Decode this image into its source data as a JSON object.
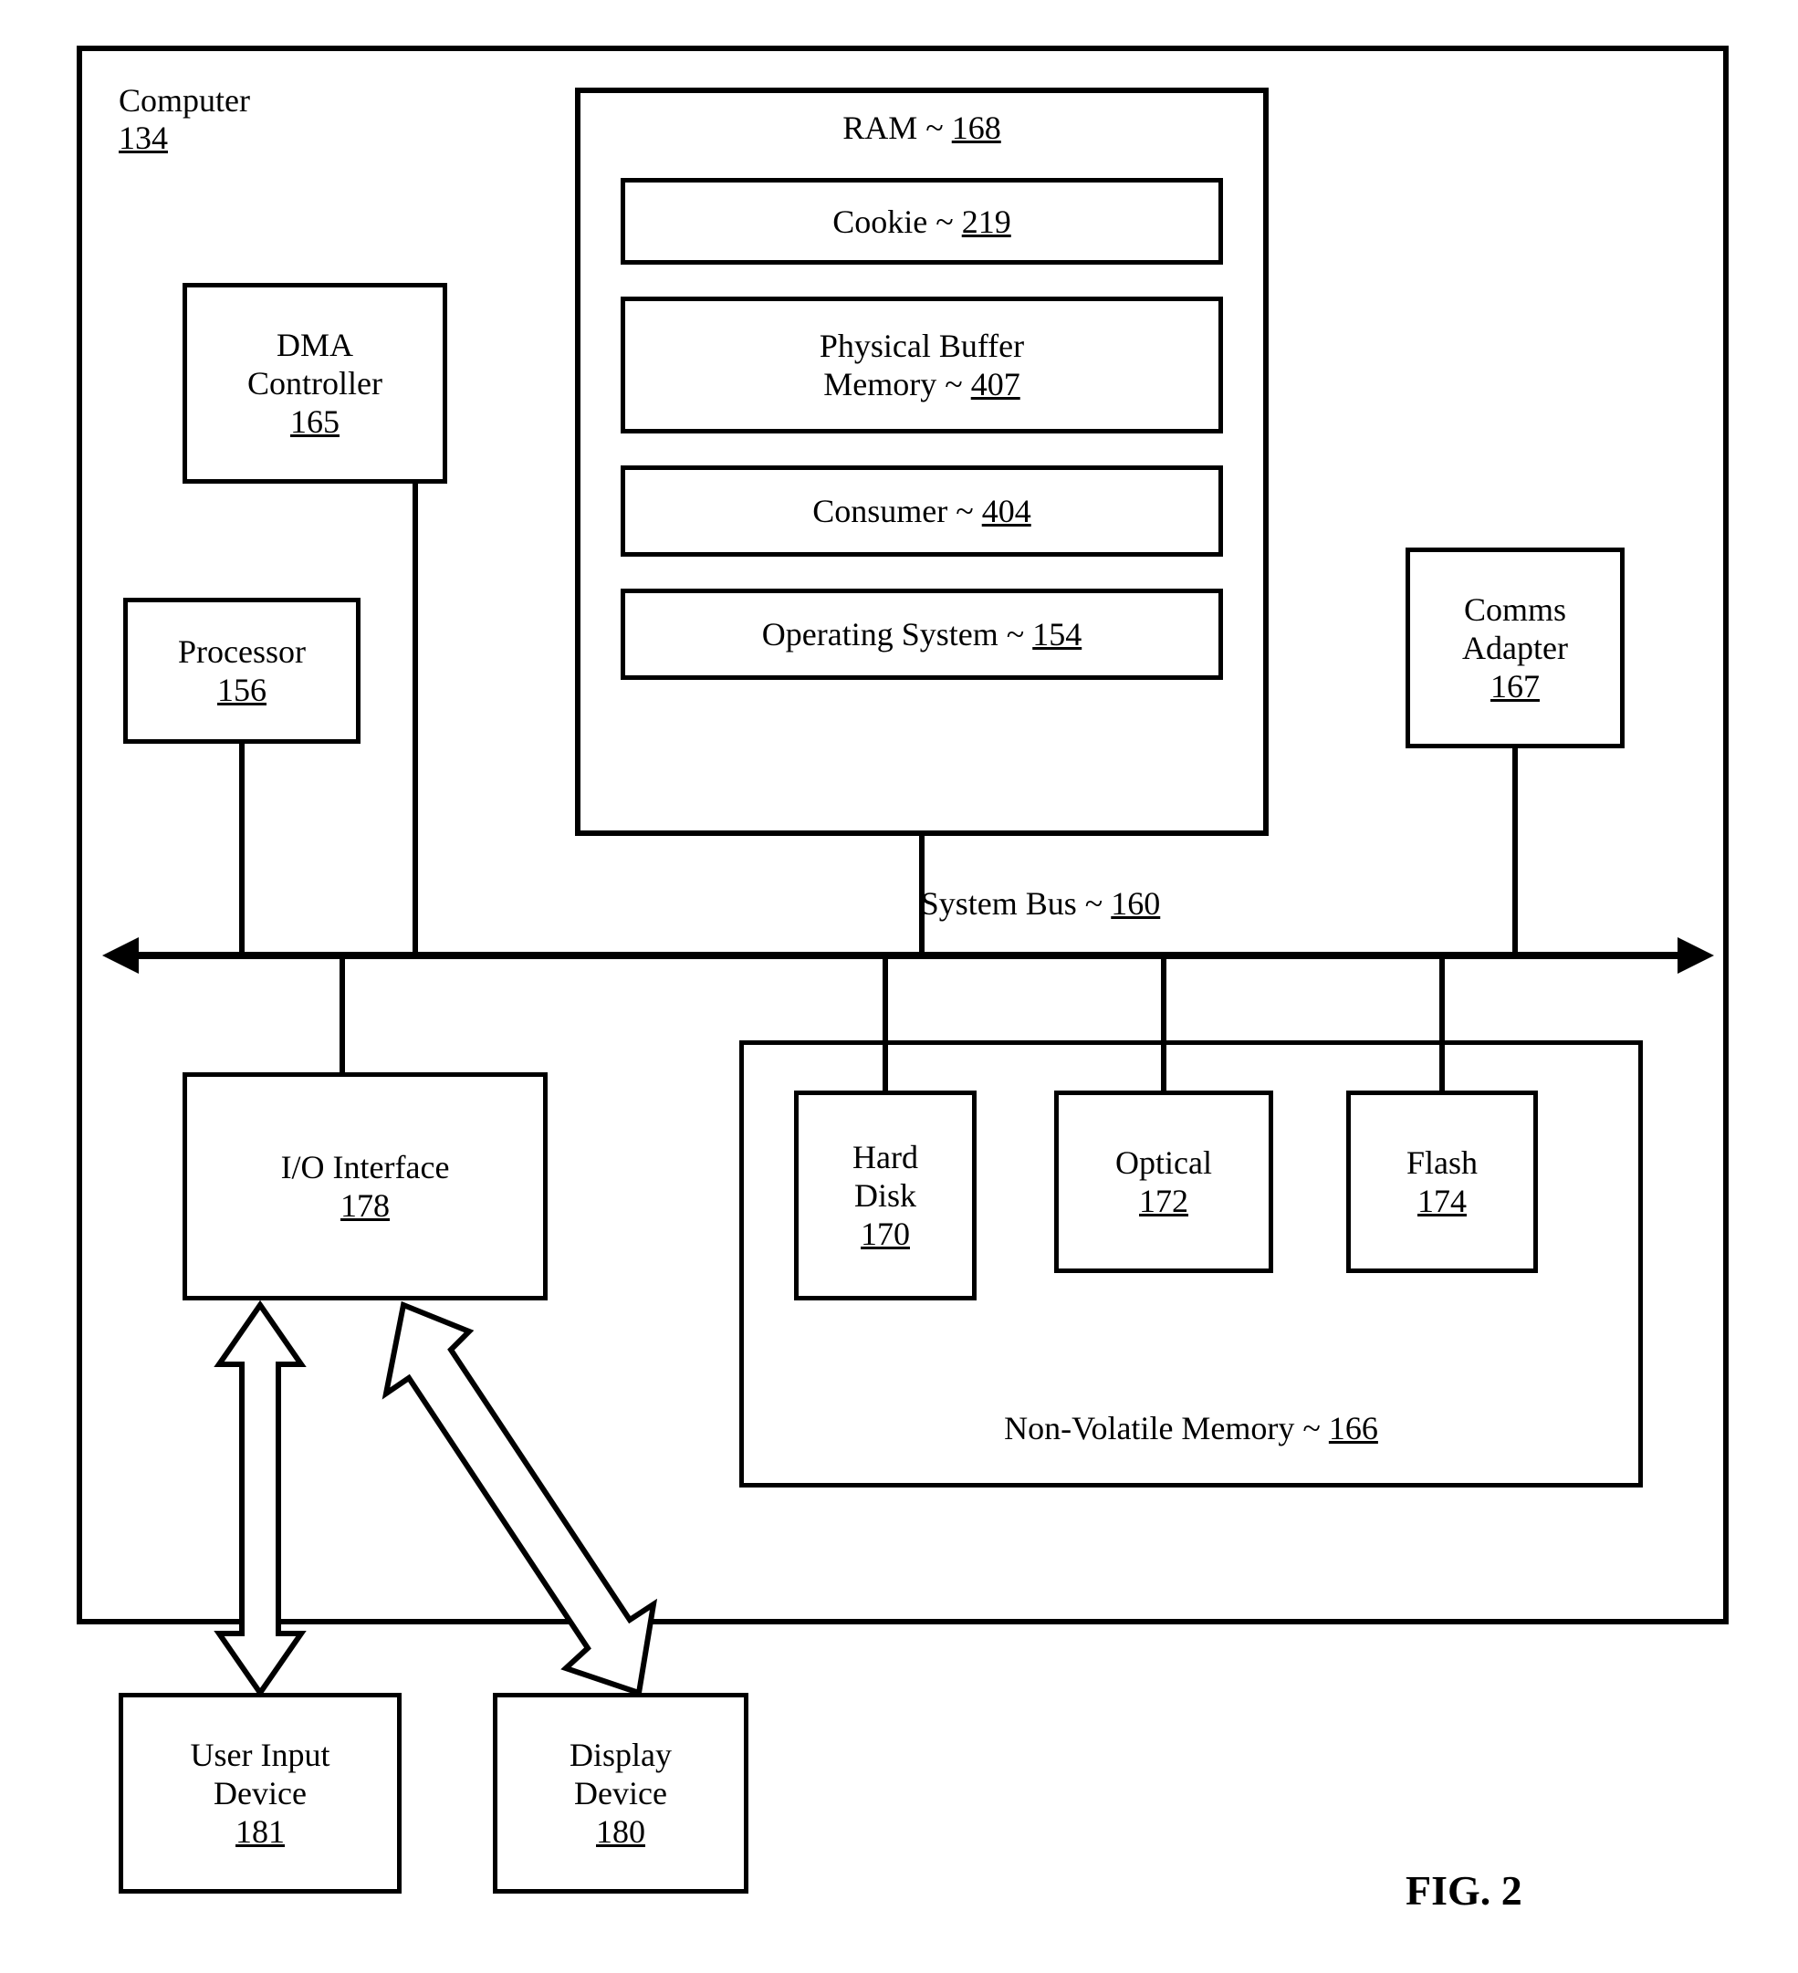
{
  "computer": {
    "label": "Computer",
    "ref": "134"
  },
  "dma": {
    "label": "DMA\nController",
    "ref": "165"
  },
  "processor": {
    "label": "Processor",
    "ref": "156"
  },
  "ram": {
    "label": "RAM ~",
    "ref": "168"
  },
  "ram_items": {
    "cookie": {
      "label": "Cookie ~",
      "ref": "219"
    },
    "pbm": {
      "label": "Physical Buffer\nMemory ~",
      "ref": "407"
    },
    "consumer": {
      "label": "Consumer ~",
      "ref": "404"
    },
    "os": {
      "label": "Operating System ~",
      "ref": "154"
    }
  },
  "comms": {
    "label": "Comms\nAdapter",
    "ref": "167"
  },
  "bus": {
    "label": "System Bus ~",
    "ref": "160"
  },
  "io": {
    "label": "I/O Interface",
    "ref": "178"
  },
  "nvm": {
    "label": "Non-Volatile Memory ~",
    "ref": "166"
  },
  "nvm_items": {
    "hd": {
      "label": "Hard\nDisk",
      "ref": "170"
    },
    "opt": {
      "label": "Optical",
      "ref": "172"
    },
    "flash": {
      "label": "Flash",
      "ref": "174"
    }
  },
  "uid": {
    "label": "User Input\nDevice",
    "ref": "181"
  },
  "display": {
    "label": "Display\nDevice",
    "ref": "180"
  },
  "figure": "FIG. 2"
}
